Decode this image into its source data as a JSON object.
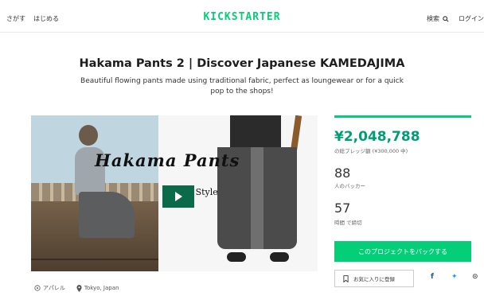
{
  "header": {
    "nav_left": [
      "さがす",
      "はじめる"
    ],
    "logo": "KICKSTARTER",
    "search_label": "検索",
    "login_label": "ログイン"
  },
  "project": {
    "title": "Hakama Pants 2 | Discover Japanese KAMEDAJIMA",
    "subtitle": "Beautiful flowing pants made using traditional fabric, perfect as loungewear or for a quick pop to the shops!"
  },
  "video": {
    "overlay_title": "Hakama Pants",
    "overlay_subtitle": "ai Style"
  },
  "meta": {
    "category": "アパレル",
    "location": "Tokyo, Japan"
  },
  "stats": {
    "pledged": "¥2,048,788",
    "pledged_sub": "の総プレッジ額 (¥300,000 中)",
    "backers": "88",
    "backers_sub": "人のバッカー",
    "days": "57",
    "days_sub": "時間 で締切",
    "progress_fraction": 1.0
  },
  "actions": {
    "back_button": "このプロジェクトをバックする",
    "remind_button": "お気に入りに登録"
  },
  "colors": {
    "brand": "#05ce78",
    "pledged_text": "#009e74"
  }
}
